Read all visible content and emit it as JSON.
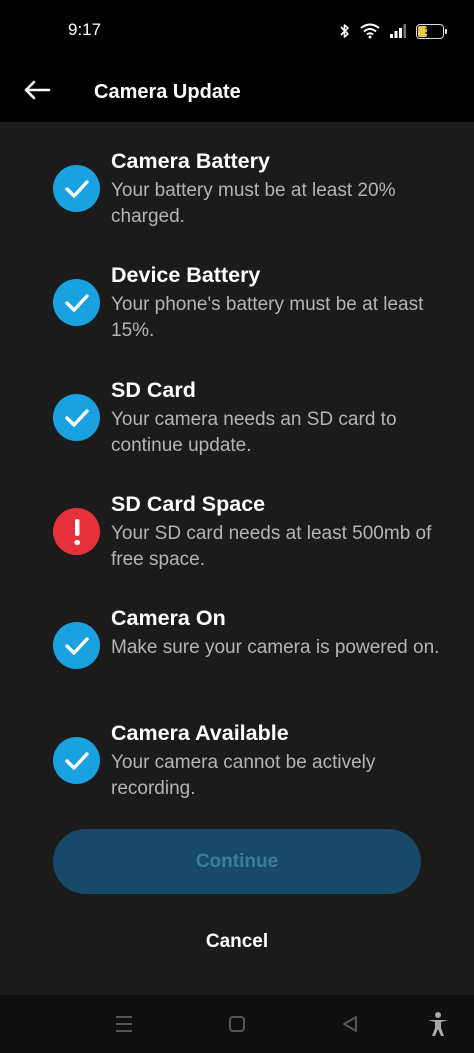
{
  "status_bar": {
    "time": "9:17",
    "battery_level": "38",
    "battery_fraction": 0.38,
    "icons": [
      "bluetooth-icon",
      "wifi-icon",
      "signal-icon",
      "battery-icon"
    ]
  },
  "header": {
    "back_icon": "arrow-left-icon",
    "title": "Camera Update"
  },
  "checklist": [
    {
      "title": "Camera Battery",
      "description": "Your battery must be at least 20% charged.",
      "status": "ok"
    },
    {
      "title": "Device Battery",
      "description": "Your phone's battery must be at least 15%.",
      "status": "ok"
    },
    {
      "title": "SD Card",
      "description": "Your camera needs an SD card to continue update.",
      "status": "ok"
    },
    {
      "title": "SD Card Space",
      "description": "Your SD card needs at least 500mb of free space.",
      "status": "error"
    },
    {
      "title": "Camera On",
      "description": "Make sure your camera is powered on.",
      "status": "ok"
    },
    {
      "title": "Camera Available",
      "description": "Your camera cannot be actively recording.",
      "status": "ok"
    }
  ],
  "actions": {
    "continue_label": "Continue",
    "continue_disabled": true,
    "cancel_label": "Cancel"
  },
  "nav_bar": {
    "icons": [
      "recents-icon",
      "home-icon",
      "back-icon",
      "accessibility-icon"
    ]
  },
  "colors": {
    "ok": "#1aa1e0",
    "error": "#e6313b",
    "continue_bg": "#174a66",
    "continue_text": "#3a7d9c"
  }
}
